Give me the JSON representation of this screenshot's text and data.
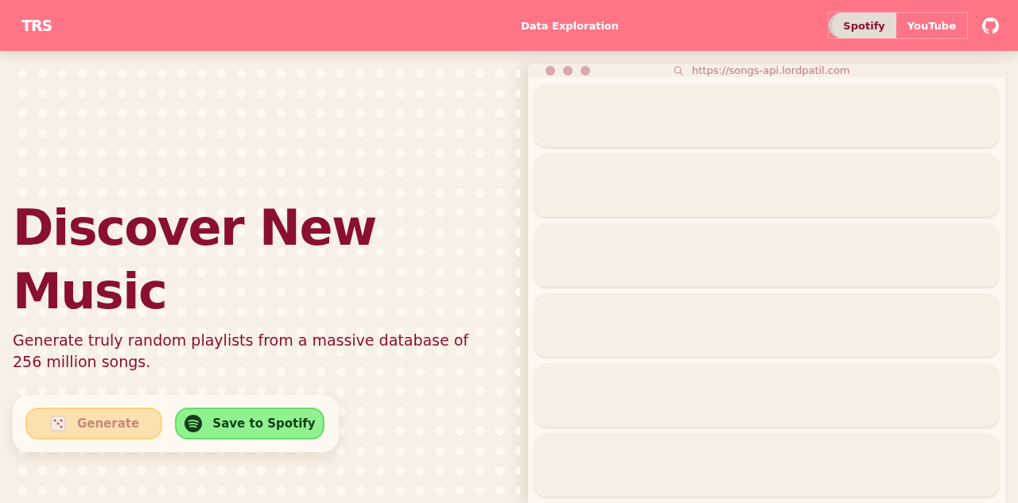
{
  "header": {
    "logo": "TRS",
    "nav_link": "Data Exploration",
    "platform_tabs": [
      {
        "label": "Spotify",
        "selected": true
      },
      {
        "label": "YouTube",
        "selected": false
      }
    ]
  },
  "hero": {
    "title": "Discover New Music",
    "subtitle": "Generate truly random playlists from a massive database of 256 million songs.",
    "buttons": [
      {
        "kind": "generate",
        "label": "Generate",
        "disabled": true
      },
      {
        "kind": "spotify",
        "label": "Save to Spotify",
        "disabled": false
      }
    ]
  },
  "browser": {
    "url": "https://songs-api.lordpatil.com"
  }
}
